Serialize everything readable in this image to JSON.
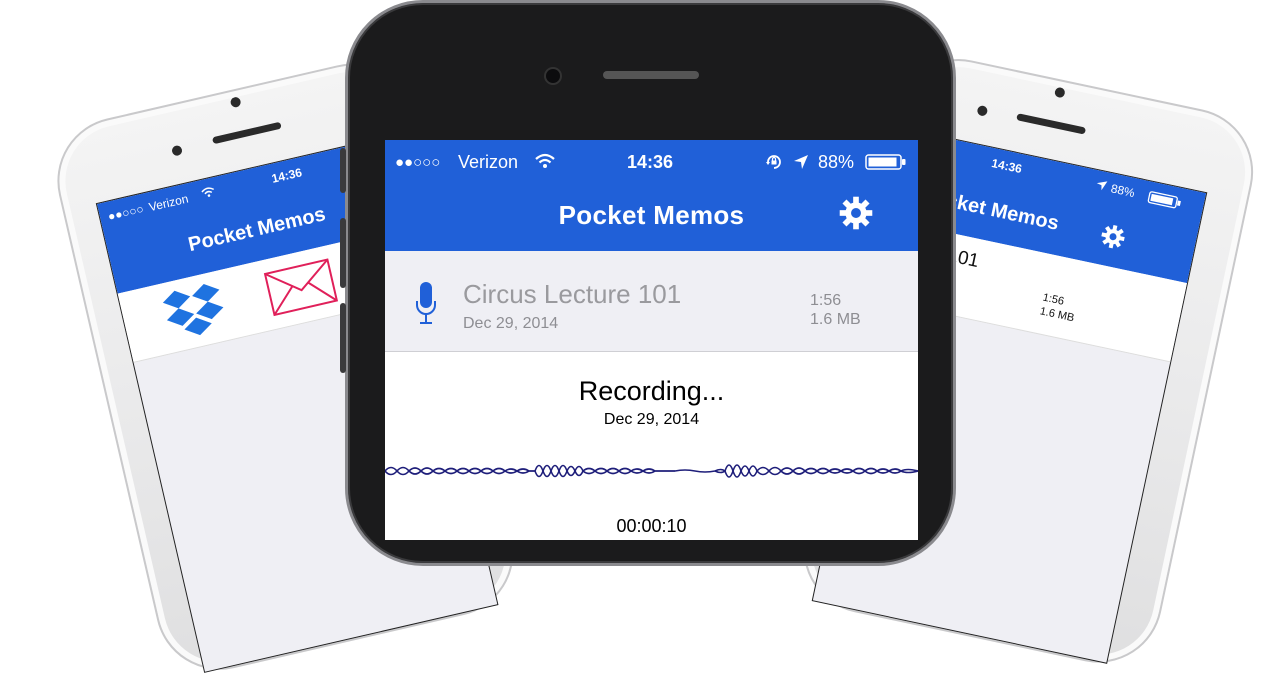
{
  "status": {
    "signal": "●●○○○",
    "carrier": "Verizon",
    "time": "14:36",
    "battery": "88%"
  },
  "app": {
    "title": "Pocket Memos"
  },
  "memo": {
    "name": "Circus Lecture 101",
    "date": "Dec 29, 2014",
    "duration": "1:56",
    "size": "1.6 MB"
  },
  "recording": {
    "label": "Recording...",
    "date": "Dec 29, 2014",
    "elapsed": "00:00:10"
  },
  "right_phone": {
    "memo_fragment": "ecture 101"
  },
  "colors": {
    "header": "#2060d8",
    "mic": "#2060d8",
    "wave": "#1e1e7a"
  },
  "icons": [
    "wifi-icon",
    "orientation-lock-icon",
    "location-icon",
    "battery-icon",
    "gear-icon",
    "microphone-icon",
    "dropbox-icon",
    "mail-icon"
  ]
}
